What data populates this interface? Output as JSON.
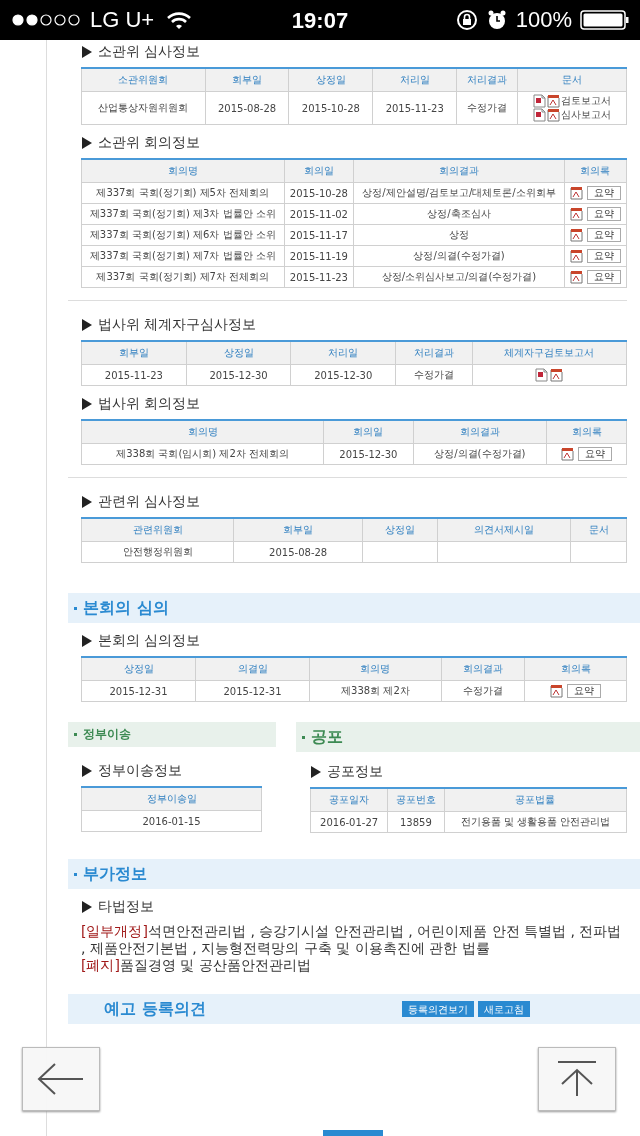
{
  "status_bar": {
    "carrier": "LG U+",
    "time": "19:07",
    "battery": "100%"
  },
  "content": [
    {
      "kind": "group",
      "subsections": [
        {
          "title": "소관위 심사정보",
          "table": {
            "columns": [
              "소관위원회",
              "회부일",
              "상정일",
              "처리일",
              "처리결과",
              "문서"
            ],
            "rows": [
              [
                "산업통상자원위원회",
                "2015-08-28",
                "2015-10-28",
                "2015-11-23",
                "수정가결",
                {
                  "kind": "docs",
                  "items": [
                    "검토보고서",
                    "심사보고서"
                  ]
                }
              ]
            ]
          }
        },
        {
          "title": "소관위 회의정보",
          "table": {
            "columns": [
              "회의명",
              "회의일",
              "회의결과",
              "회의록"
            ],
            "rows": [
              [
                "제337회 국회(정기회) 제5차 전체회의",
                "2015-10-28",
                "상정/제안설명/검토보고/대체토론/소위회부",
                {
                  "kind": "minutes",
                  "button": "요약"
                }
              ],
              [
                "제337회 국회(정기회) 제3차 법률안 소위",
                "2015-11-02",
                "상정/축조심사",
                {
                  "kind": "minutes",
                  "button": "요약"
                }
              ],
              [
                "제337회 국회(정기회) 제6차 법률안 소위",
                "2015-11-17",
                "상정",
                {
                  "kind": "minutes",
                  "button": "요약"
                }
              ],
              [
                "제337회 국회(정기회) 제7차 법률안 소위",
                "2015-11-19",
                "상정/의결(수정가결)",
                {
                  "kind": "minutes",
                  "button": "요약"
                }
              ],
              [
                "제337회 국회(정기회) 제7차 전체회의",
                "2015-11-23",
                "상정/소위심사보고/의결(수정가결)",
                {
                  "kind": "minutes",
                  "button": "요약"
                }
              ]
            ]
          }
        }
      ]
    },
    {
      "kind": "group",
      "subsections": [
        {
          "title": "법사위 체계자구심사정보",
          "table": {
            "columns": [
              "회부일",
              "상정일",
              "처리일",
              "처리결과",
              "체계자구검토보고서"
            ],
            "rows": [
              [
                "2015-11-23",
                "2015-12-30",
                "2015-12-30",
                "수정가결",
                {
                  "kind": "files"
                }
              ]
            ]
          }
        },
        {
          "title": "법사위 회의정보",
          "table": {
            "columns": [
              "회의명",
              "회의일",
              "회의결과",
              "회의록"
            ],
            "rows": [
              [
                "제338회 국회(임시회) 제2차 전체회의",
                "2015-12-30",
                "상정/의결(수정가결)",
                {
                  "kind": "minutes",
                  "button": "요약"
                }
              ]
            ]
          }
        }
      ]
    },
    {
      "kind": "group",
      "subsections": [
        {
          "title": "관련위 심사정보",
          "table": {
            "columns": [
              "관련위원회",
              "회부일",
              "상정일",
              "의견서제시일",
              "문서"
            ],
            "rows": [
              [
                "안전행정위원회",
                "2015-08-28",
                {
                  "kind": "empty"
                },
                {
                  "kind": "empty"
                },
                {
                  "kind": "empty"
                }
              ]
            ]
          }
        }
      ]
    },
    {
      "kind": "section",
      "color": "#2a8ad1",
      "title": "본회의 심의",
      "subsections": [
        {
          "title": "본회의 심의정보",
          "table": {
            "columns": [
              "상정일",
              "의결일",
              "회의명",
              "회의결과",
              "회의록"
            ],
            "rows": [
              [
                "2015-12-31",
                "2015-12-31",
                "제338회 제2차",
                "수정가결",
                {
                  "kind": "minutes",
                  "button": "요약"
                }
              ]
            ]
          }
        }
      ]
    },
    {
      "kind": "split",
      "panels": [
        {
          "color": "#3d8a53",
          "title": "정부이송",
          "subsections": [
            {
              "title": "정부이송정보",
              "table": {
                "columns": [
                  "정부이송일"
                ],
                "rows": [
                  [
                    "2016-01-15"
                  ]
                ]
              }
            }
          ]
        },
        {
          "color": "#3d8a53",
          "title": "공포",
          "subsections": [
            {
              "title": "공포정보",
              "table": {
                "columns": [
                  "공포일자",
                  "공포번호",
                  "공포법률"
                ],
                "rows": [
                  [
                    "2016-01-27",
                    "13859",
                    "전기용품 및 생활용품 안전관리법"
                  ]
                ]
              }
            }
          ]
        }
      ]
    },
    {
      "kind": "section",
      "color": "#2a8ad1",
      "title": "부가정보",
      "subsections": [
        {
          "title": "타법정보",
          "entries": [
            {
              "tag": "[일부개정]",
              "text": "석면안전관리법 , 승강기시설 안전관리법 , 어린이제품 안전 특별법 , 전파법 , 제품안전기본법 , 지능형전력망의 구축 및 이용촉진에 관한 법률"
            },
            {
              "tag": "[폐지]",
              "text": "품질경영 및 공산품안전관리법"
            }
          ]
        }
      ]
    },
    {
      "kind": "section",
      "color": "#2a8ad1",
      "title": "예고 등록의견",
      "buttons": [
        "등록의견보기",
        "새로고침"
      ]
    }
  ]
}
